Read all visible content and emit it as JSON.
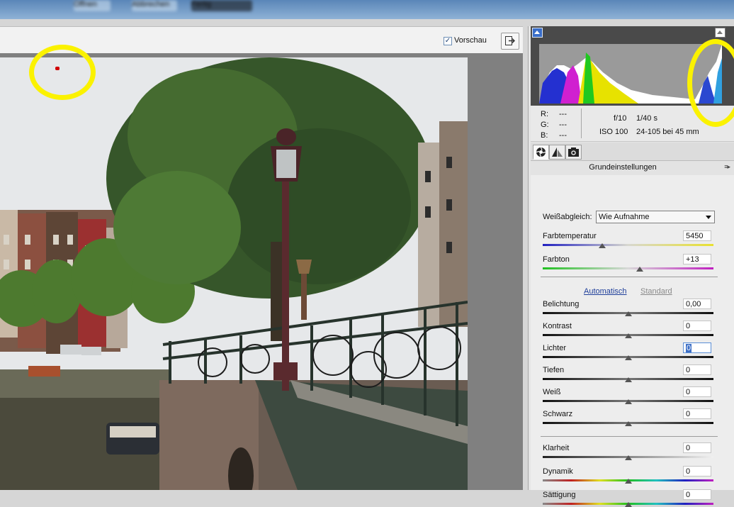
{
  "topbar": {
    "blurred_buttons": [
      {
        "label": "Öffnen"
      },
      {
        "label": "Abbrechen"
      },
      {
        "label": "Fertig"
      }
    ]
  },
  "preview": {
    "checkbox_label": "Vorschau",
    "checked": true
  },
  "histogram": {
    "colors": {
      "background": "#4a4a4a",
      "plot": "#9a9a9a",
      "clip_warning": "#3a6ec9"
    }
  },
  "info": {
    "r_label": "R:",
    "r_value": "---",
    "g_label": "G:",
    "g_value": "---",
    "b_label": "B:",
    "b_value": "---",
    "aperture": "f/10",
    "shutter": "1/40 s",
    "iso": "ISO 100",
    "lens": "24-105 bei 45 mm"
  },
  "tabs": [
    {
      "icon": "aperture-icon",
      "active": true
    },
    {
      "icon": "tone-curve-icon",
      "active": false
    },
    {
      "icon": "camera-icon",
      "active": false
    }
  ],
  "section": {
    "title": "Grundeinstellungen",
    "menu_glyph": "≡▸"
  },
  "white_balance": {
    "label": "Weißabgleich:",
    "selected": "Wie Aufnahme"
  },
  "sliders_wb": [
    {
      "label": "Farbtemperatur",
      "value": "5450",
      "position": 0.35,
      "track": "temp"
    },
    {
      "label": "Farbton",
      "value": "+13",
      "position": 0.57,
      "track": "tint"
    }
  ],
  "auto_links": {
    "auto": "Automatisch",
    "standard": "Standard"
  },
  "sliders_tone": [
    {
      "label": "Belichtung",
      "value": "0,00",
      "position": 0.5
    },
    {
      "label": "Kontrast",
      "value": "0",
      "position": 0.5
    },
    {
      "label": "Lichter",
      "value": "0",
      "position": 0.5,
      "focused": true
    },
    {
      "label": "Tiefen",
      "value": "0",
      "position": 0.5
    },
    {
      "label": "Weiß",
      "value": "0",
      "position": 0.5
    },
    {
      "label": "Schwarz",
      "value": "0",
      "position": 0.5
    }
  ],
  "sliders_presence": [
    {
      "label": "Klarheit",
      "value": "0",
      "position": 0.5,
      "track": "gray"
    },
    {
      "label": "Dynamik",
      "value": "0",
      "position": 0.5,
      "track": "spectrum"
    },
    {
      "label": "Sättigung",
      "value": "0",
      "position": 0.5,
      "track": "spectrum"
    }
  ],
  "annotations": {
    "highlight_color": "#fbf200",
    "clip_marker_color": "#d00000"
  }
}
